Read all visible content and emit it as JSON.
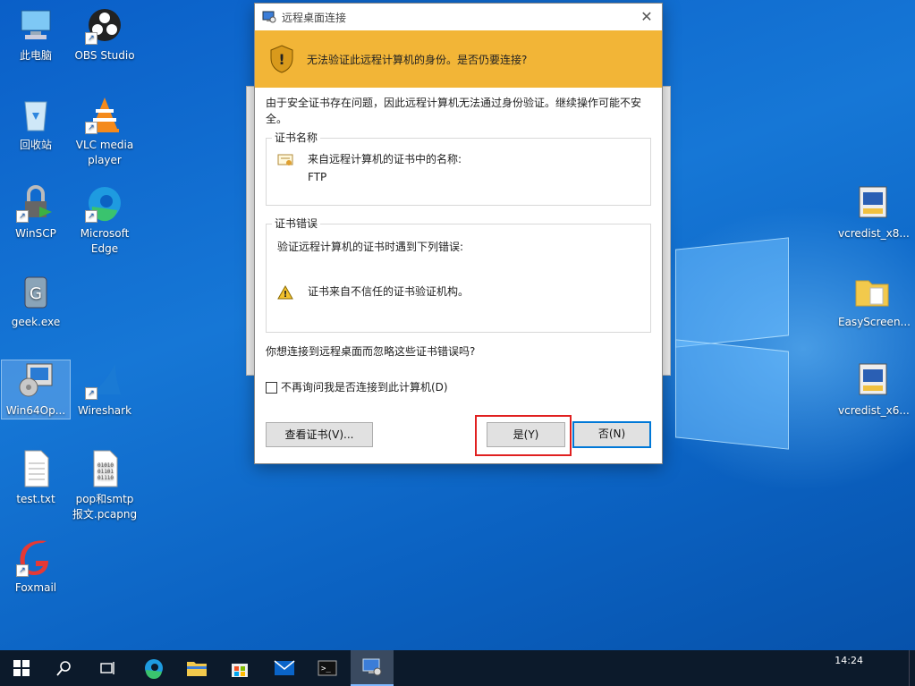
{
  "desktop": {
    "icons_left": [
      {
        "label": "此电脑",
        "icon": "pc-icon"
      },
      {
        "label": "OBS Studio",
        "icon": "obs-icon"
      },
      {
        "label": "回收站",
        "icon": "recycle-bin-icon"
      },
      {
        "label": "VLC media player",
        "icon": "vlc-icon"
      },
      {
        "label": "WinSCP",
        "icon": "winscp-icon"
      },
      {
        "label": "Microsoft Edge",
        "icon": "edge-icon"
      },
      {
        "label": "geek.exe",
        "icon": "geek-icon"
      },
      {
        "label": "Win64Op...",
        "icon": "installer-icon"
      },
      {
        "label": "Wireshark",
        "icon": "wireshark-icon"
      },
      {
        "label": "test.txt",
        "icon": "text-file-icon"
      },
      {
        "label": "pop和smtp报文.pcapng",
        "icon": "pcap-file-icon"
      },
      {
        "label": "Foxmail",
        "icon": "foxmail-icon"
      }
    ],
    "icons_right": [
      {
        "label": "vcredist_x8...",
        "icon": "installer-icon"
      },
      {
        "label": "EasyScreen...",
        "icon": "folder-icon"
      },
      {
        "label": "vcredist_x6...",
        "icon": "installer-icon"
      }
    ]
  },
  "dialog": {
    "title": "远程桌面连接",
    "banner": "无法验证此远程计算机的身份。是否仍要连接?",
    "intro": "由于安全证书存在问题，因此远程计算机无法通过身份验证。继续操作可能不安全。",
    "cert_name_group": "证书名称",
    "cert_name_label": "来自远程计算机的证书中的名称:",
    "cert_name_value": "FTP",
    "cert_error_group": "证书错误",
    "cert_error_intro": "验证远程计算机的证书时遇到下列错误:",
    "cert_error_item": "证书来自不信任的证书验证机构。",
    "question": "你想连接到远程桌面而忽略这些证书错误吗?",
    "checkbox_label": "不再询问我是否连接到此计算机(D)",
    "view_cert_button": "查看证书(V)...",
    "yes_button": "是(Y)",
    "no_button": "否(N)"
  },
  "taskbar": {
    "time": "14:24"
  },
  "colors": {
    "banner": "#f2b537",
    "highlight": "#e02020",
    "taskbar": "#0c1a2b"
  }
}
